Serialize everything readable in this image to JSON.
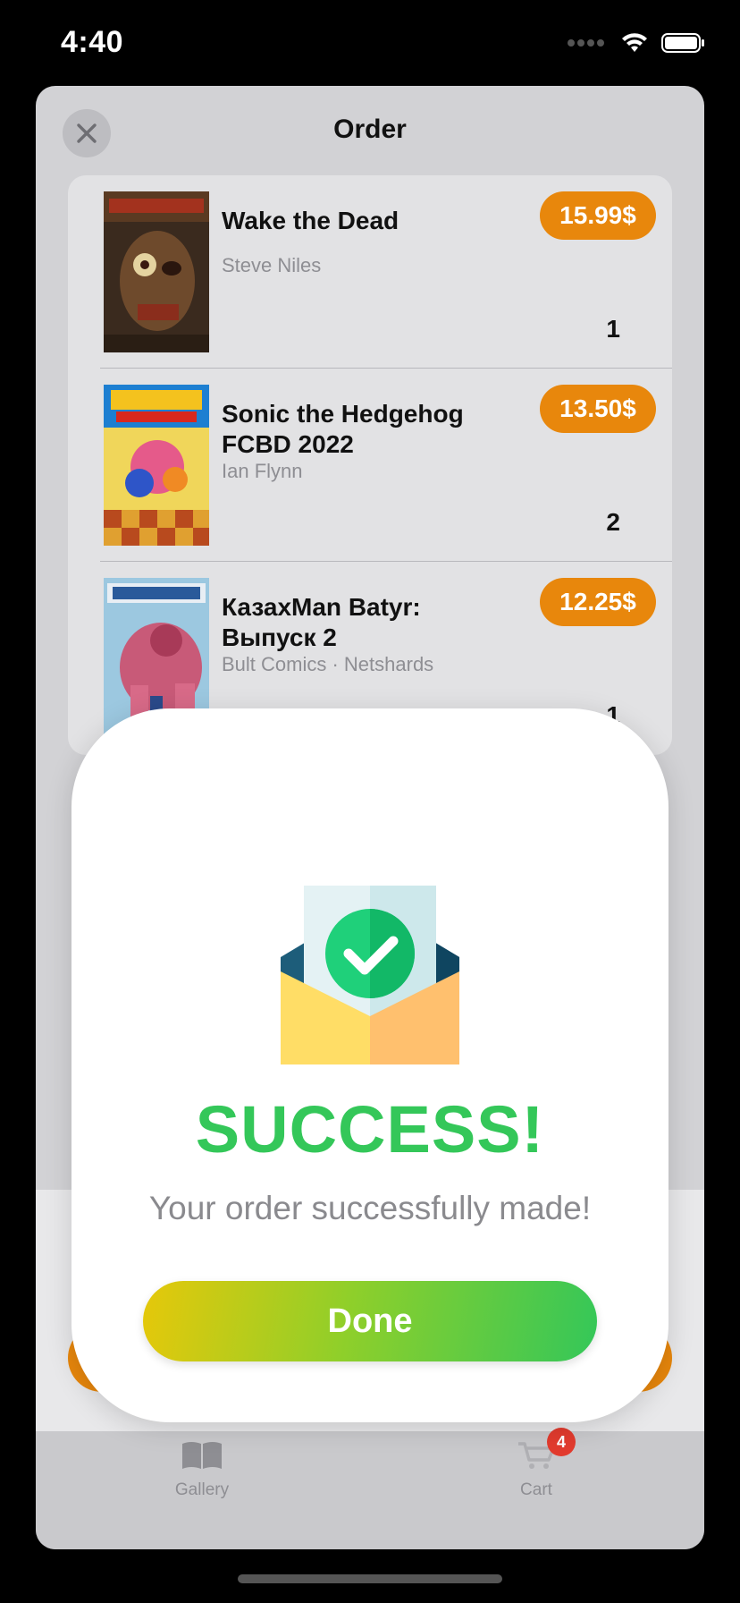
{
  "status_bar": {
    "time": "4:40"
  },
  "sheet": {
    "title": "Order"
  },
  "order_items": [
    {
      "title": "Wake the Dead",
      "author": "Steve Niles",
      "price": "15.99$",
      "quantity": "1"
    },
    {
      "title": "Sonic the Hedgehog FCBD 2022",
      "author": "Ian Flynn",
      "price": "13.50$",
      "quantity": "2"
    },
    {
      "title": "КазахMan Batyr: Выпуск 2",
      "author": "Bult Comics · Netshards",
      "price": "12.25$",
      "quantity": "1"
    }
  ],
  "tabbar": {
    "gallery_label": "Gallery",
    "cart_label": "Cart",
    "cart_badge": "4"
  },
  "success_dialog": {
    "heading": "SUCCESS!",
    "message": "Your order successfully made!",
    "done_label": "Done"
  },
  "colors": {
    "accent_orange": "#e8870c",
    "success_green": "#34c759",
    "badge_red": "#e23b2e"
  }
}
